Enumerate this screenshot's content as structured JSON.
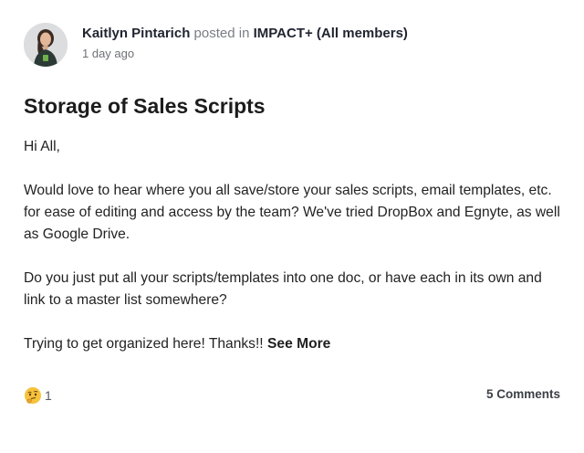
{
  "post": {
    "author": "Kaitlyn Pintarich",
    "posted_in_text": "posted in",
    "group": "IMPACT+ (All members)",
    "timestamp": "1 day ago",
    "title": "Storage of Sales Scripts",
    "body": {
      "paragraph_1": "Hi All,",
      "paragraph_2": "Would love to hear where you all save/store your sales scripts, email templates, etc. for ease of editing and access by the team? We've tried DropBox and Egnyte, as well as Google Drive.",
      "paragraph_3": "Do you just put all your scripts/templates into one doc, or have each in its own and link to a master list somewhere?",
      "paragraph_4": "Trying to get organized here! Thanks!!"
    },
    "see_more_label": "See More",
    "reaction": {
      "icon": "thinking-face-emoji",
      "count": "1"
    },
    "comments_label": "5 Comments"
  },
  "colors": {
    "author": "#1f2430",
    "muted": "#7a7d83",
    "text": "#222222",
    "emoji": "#f7c23c"
  }
}
